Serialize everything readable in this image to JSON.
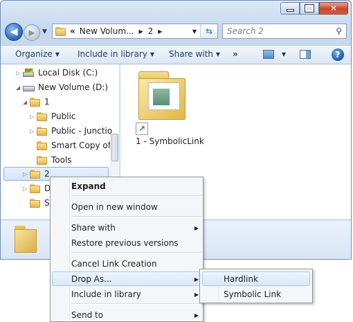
{
  "address": {
    "overflow": "«",
    "crumbs": [
      "New Volum...",
      "2"
    ],
    "search_placeholder": "Search 2"
  },
  "toolbar": {
    "organize": "Organize",
    "include": "Include in library",
    "share": "Share with",
    "more": "»"
  },
  "tree": [
    {
      "label": "Local Disk (C:)"
    },
    {
      "label": "New Volume (D:)"
    },
    {
      "label": "1"
    },
    {
      "label": "Public"
    },
    {
      "label": "Public - Junctio"
    },
    {
      "label": "Smart Copy of T"
    },
    {
      "label": "Tools"
    },
    {
      "label": "2"
    },
    {
      "label": "D"
    },
    {
      "label": "Sy"
    }
  ],
  "content": {
    "file_name": "1 - SymbolicLink"
  },
  "context_menu": {
    "expand": "Expand",
    "open_new_window": "Open in new window",
    "share_with": "Share with",
    "restore": "Restore previous versions",
    "cancel_link": "Cancel Link Creation",
    "drop_as": "Drop As...",
    "include_library": "Include in library",
    "send_to": "Send to"
  },
  "submenu": {
    "hardlink": "Hardlink",
    "symbolic": "Symbolic Link"
  },
  "colors": {
    "selection": "#d3e6fa",
    "accent": "#2565b8",
    "close": "#c7452c"
  }
}
